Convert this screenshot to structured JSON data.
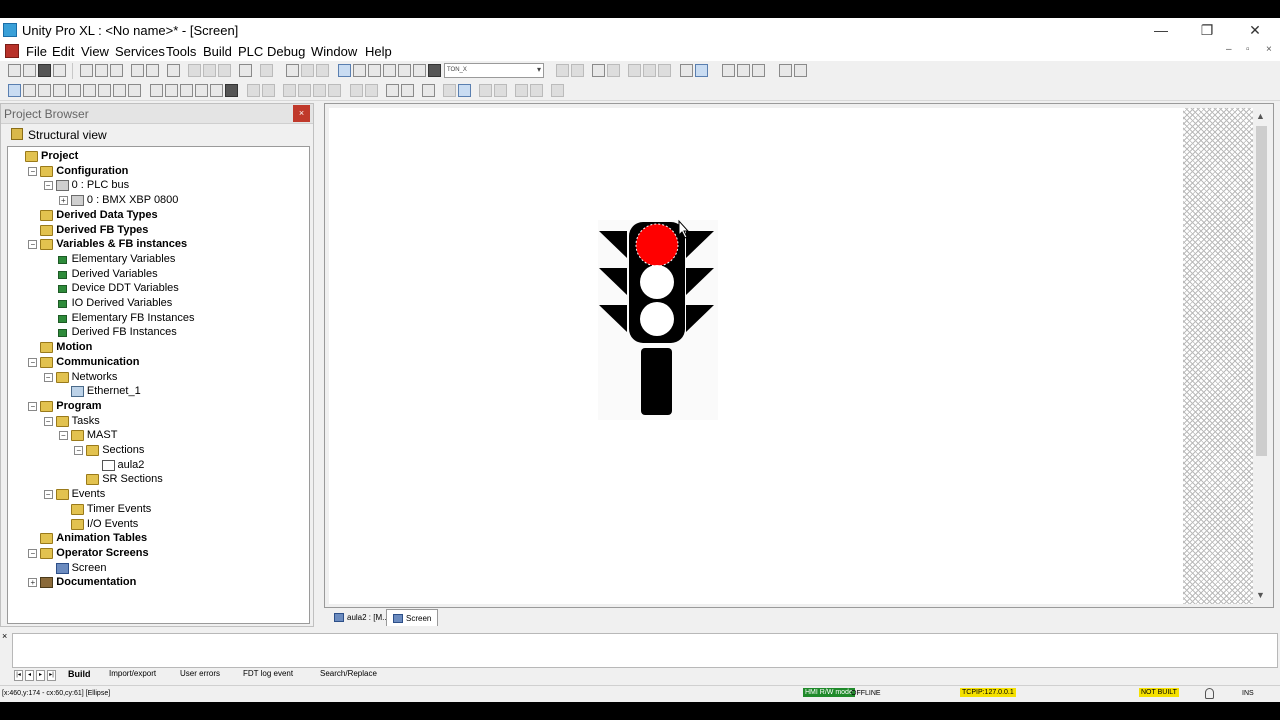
{
  "window": {
    "title": "Unity Pro XL : <No name>* - [Screen]",
    "minimize": "—",
    "restore": "❐",
    "close": "✕"
  },
  "menu": [
    "File",
    "Edit",
    "View",
    "Services",
    "Tools",
    "Build",
    "PLC",
    "Debug",
    "Window",
    "Help"
  ],
  "mdi_controls": [
    "–",
    "▫",
    "×"
  ],
  "toolbar": {
    "combo_value": "TON_X"
  },
  "project_browser": {
    "title": "Project Browser",
    "close": "×",
    "view": "Structural view",
    "tree": [
      {
        "label": "Project",
        "depth": 0,
        "bold": true,
        "icon": "folder-open",
        "expander": ""
      },
      {
        "label": "Configuration",
        "depth": 1,
        "bold": true,
        "icon": "folder-open",
        "expander": "−"
      },
      {
        "label": "0 : PLC bus",
        "depth": 2,
        "bold": false,
        "icon": "device",
        "expander": "−"
      },
      {
        "label": "0 : BMX XBP 0800",
        "depth": 3,
        "bold": false,
        "icon": "device",
        "expander": "+"
      },
      {
        "label": "Derived Data Types",
        "depth": 1,
        "bold": true,
        "icon": "folder",
        "expander": ""
      },
      {
        "label": "Derived FB Types",
        "depth": 1,
        "bold": true,
        "icon": "folder",
        "expander": ""
      },
      {
        "label": "Variables & FB instances",
        "depth": 1,
        "bold": true,
        "icon": "folder-open",
        "expander": "−"
      },
      {
        "label": "Elementary Variables",
        "depth": 2,
        "bold": false,
        "icon": "green",
        "expander": ""
      },
      {
        "label": "Derived Variables",
        "depth": 2,
        "bold": false,
        "icon": "green",
        "expander": ""
      },
      {
        "label": "Device DDT Variables",
        "depth": 2,
        "bold": false,
        "icon": "green",
        "expander": ""
      },
      {
        "label": "IO Derived Variables",
        "depth": 2,
        "bold": false,
        "icon": "green",
        "expander": ""
      },
      {
        "label": "Elementary FB Instances",
        "depth": 2,
        "bold": false,
        "icon": "green",
        "expander": ""
      },
      {
        "label": "Derived FB Instances",
        "depth": 2,
        "bold": false,
        "icon": "green",
        "expander": ""
      },
      {
        "label": "Motion",
        "depth": 1,
        "bold": true,
        "icon": "folder",
        "expander": ""
      },
      {
        "label": "Communication",
        "depth": 1,
        "bold": true,
        "icon": "folder-open",
        "expander": "−"
      },
      {
        "label": "Networks",
        "depth": 2,
        "bold": false,
        "icon": "folder-open",
        "expander": "−"
      },
      {
        "label": "Ethernet_1",
        "depth": 3,
        "bold": false,
        "icon": "net",
        "expander": ""
      },
      {
        "label": "Program",
        "depth": 1,
        "bold": true,
        "icon": "folder-open",
        "expander": "−"
      },
      {
        "label": "Tasks",
        "depth": 2,
        "bold": false,
        "icon": "folder-open",
        "expander": "−"
      },
      {
        "label": "MAST",
        "depth": 3,
        "bold": false,
        "icon": "folder-open",
        "expander": "−"
      },
      {
        "label": "Sections",
        "depth": 4,
        "bold": false,
        "icon": "folder-open",
        "expander": "−"
      },
      {
        "label": "aula2",
        "depth": 5,
        "bold": false,
        "icon": "section",
        "expander": ""
      },
      {
        "label": "SR Sections",
        "depth": 4,
        "bold": false,
        "icon": "folder",
        "expander": ""
      },
      {
        "label": "Events",
        "depth": 2,
        "bold": false,
        "icon": "folder-open",
        "expander": "−"
      },
      {
        "label": "Timer Events",
        "depth": 3,
        "bold": false,
        "icon": "folder",
        "expander": ""
      },
      {
        "label": "I/O Events",
        "depth": 3,
        "bold": false,
        "icon": "folder",
        "expander": ""
      },
      {
        "label": "Animation Tables",
        "depth": 1,
        "bold": true,
        "icon": "folder",
        "expander": ""
      },
      {
        "label": "Operator Screens",
        "depth": 1,
        "bold": true,
        "icon": "folder-open",
        "expander": "−"
      },
      {
        "label": "Screen",
        "depth": 2,
        "bold": false,
        "icon": "screen",
        "expander": ""
      },
      {
        "label": "Documentation",
        "depth": 1,
        "bold": true,
        "icon": "doc",
        "expander": "+"
      }
    ]
  },
  "editor_tabs": [
    {
      "label": "aula2 : [M...",
      "active": false
    },
    {
      "label": "Screen",
      "active": true
    }
  ],
  "output_tabs": [
    "Build",
    "Import/export",
    "User errors",
    "FDT log event",
    "Search/Replace"
  ],
  "status": {
    "coords": "[x:460,y:174 - cx:60,cy:61] [Ellipse]",
    "hmi_mode": "HMI R/W mode",
    "connection": "OFFLINE",
    "address": "TCPIP:127.0.0.1",
    "build": "NOT BUILT",
    "ins": "INS"
  },
  "colors": {
    "red_lamp": "#ff0000",
    "traffic_light_body": "#000000",
    "hmi_badge": "#1f8a2a",
    "status_highlight": "#f5e100"
  }
}
